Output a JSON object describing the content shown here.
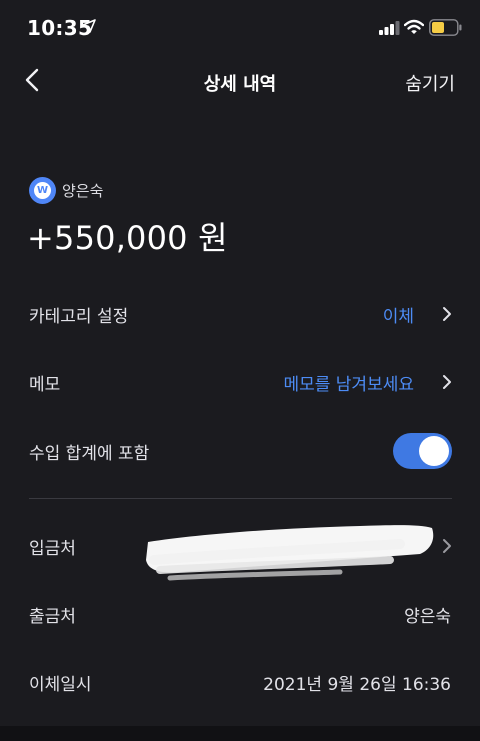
{
  "status_bar": {
    "time": "10:35"
  },
  "nav": {
    "title": "상세 내역",
    "hide_label": "숨기기"
  },
  "account": {
    "icon_letter": "W",
    "name": "양은숙",
    "amount": "+550,000 원"
  },
  "rows": {
    "category": {
      "label": "카테고리 설정",
      "value": "이체"
    },
    "memo": {
      "label": "메모",
      "value": "메모를 남겨보세요"
    },
    "include_income": {
      "label": "수입 합계에 포함",
      "enabled": true
    },
    "deposit_to": {
      "label": "입금처"
    },
    "withdraw_from": {
      "label": "출금처",
      "value": "양은숙"
    },
    "transfer_time": {
      "label": "이체일시",
      "value": "2021년 9월 26일 16:36"
    }
  },
  "colors": {
    "background": "#1b1b1f",
    "accent_blue": "#4d8cf5",
    "toggle_on": "#3f79e3"
  }
}
